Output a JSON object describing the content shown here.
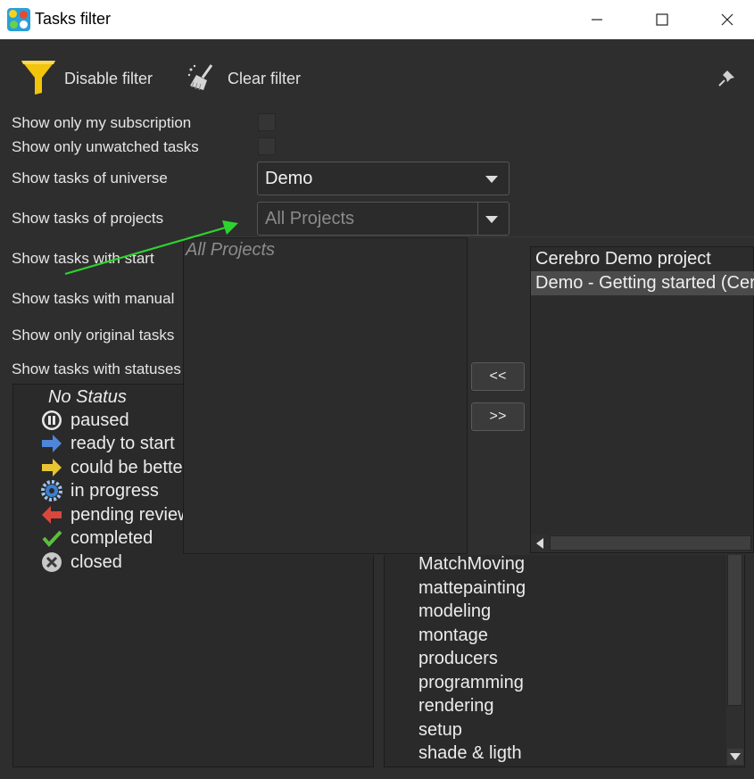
{
  "window": {
    "title": "Tasks filter",
    "minimize_glyph": "—",
    "maximize_glyph": "☐",
    "close_glyph": "✕"
  },
  "toolbar": {
    "disable_filter_label": "Disable filter",
    "clear_filter_label": "Clear filter",
    "pin_icon": "pin-icon"
  },
  "filters": {
    "subscription_label": "Show only my subscription",
    "unwatched_label": "Show only unwatched tasks",
    "universe_label": "Show tasks of universe",
    "universe_value": "Demo",
    "projects_label": "Show tasks of projects",
    "projects_value": "All Projects",
    "start_label": "Show tasks with start",
    "manual_label": "Show tasks with manual",
    "original_label": "Show only original tasks",
    "statuses_label": "Show tasks with statuses"
  },
  "statuses": [
    {
      "label": "No Status",
      "icon": "none"
    },
    {
      "label": "paused",
      "icon": "pause-icon"
    },
    {
      "label": "ready to start",
      "icon": "blue-arrow-icon"
    },
    {
      "label": "could be better",
      "icon": "yellow-arrow-icon"
    },
    {
      "label": "in progress",
      "icon": "gear-icon"
    },
    {
      "label": "pending review",
      "icon": "red-arrow-icon"
    },
    {
      "label": "completed",
      "icon": "checkmark-icon"
    },
    {
      "label": "closed",
      "icon": "closed-x-icon"
    }
  ],
  "activities": [
    "MatchMoving",
    "mattepainting",
    "modeling",
    "montage",
    "producers",
    "programming",
    "rendering",
    "setup",
    "shade & ligth"
  ],
  "dropdown": {
    "selected_placeholder": "All Projects",
    "remove_button": "<<",
    "add_button": ">>",
    "available_projects": [
      "Cerebro Demo project",
      "Demo - Getting started (Cerebro)"
    ]
  },
  "colors": {
    "accent_green": "#2fd32f",
    "window_bg": "#2e2e2e",
    "funnel_yellow": "#f2c40c"
  }
}
